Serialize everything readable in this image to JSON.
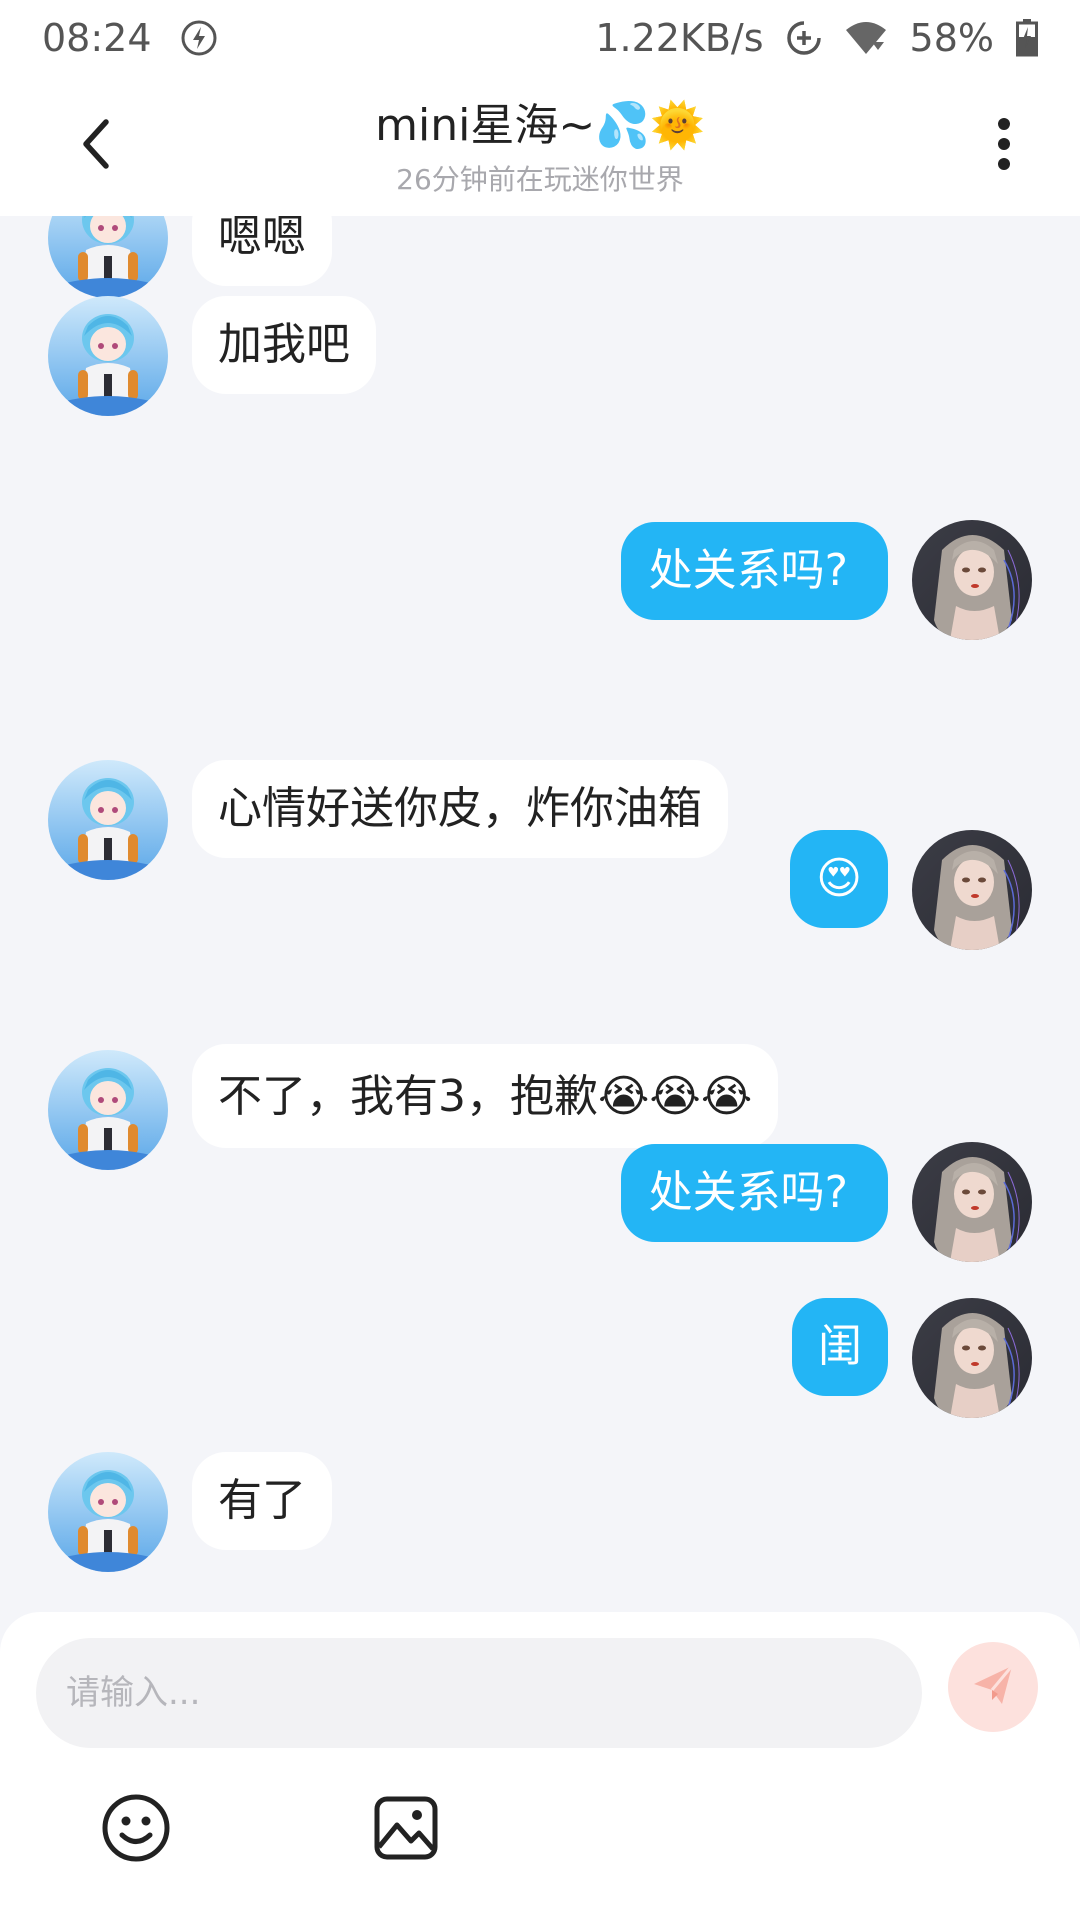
{
  "status_bar": {
    "time": "08:24",
    "network_speed": "1.22KB/s",
    "battery": "58%",
    "icons": [
      "lightning-icon",
      "data-saver-icon",
      "wifi-icon",
      "battery-icon"
    ]
  },
  "header": {
    "title": "mini星海~💦🌞",
    "subtitle": "26分钟前在玩迷你世界",
    "icons": [
      "back-icon",
      "more-icon"
    ]
  },
  "messages": [
    {
      "side": "left",
      "text": "嗯嗯"
    },
    {
      "side": "left",
      "text": "加我吧"
    },
    {
      "side": "right",
      "text": "处关系吗?"
    },
    {
      "side": "left",
      "text": "心情好送你皮，炸你油箱"
    },
    {
      "side": "right",
      "text": "😍"
    },
    {
      "side": "left",
      "text": "不了，我有3，抱歉😭😭😭"
    },
    {
      "side": "right",
      "text": "处关系吗?"
    },
    {
      "side": "right",
      "text": "闺"
    },
    {
      "side": "left",
      "text": "有了"
    }
  ],
  "input": {
    "placeholder": "请输入...",
    "value": ""
  },
  "toolbar": {
    "icons": [
      "emoji-icon",
      "image-icon",
      "send-icon"
    ]
  },
  "colors": {
    "accent": "#23b5f5",
    "background": "#f4f5f9",
    "send_button_bg": "#fde1dd",
    "send_icon": "#f7b3a8"
  }
}
